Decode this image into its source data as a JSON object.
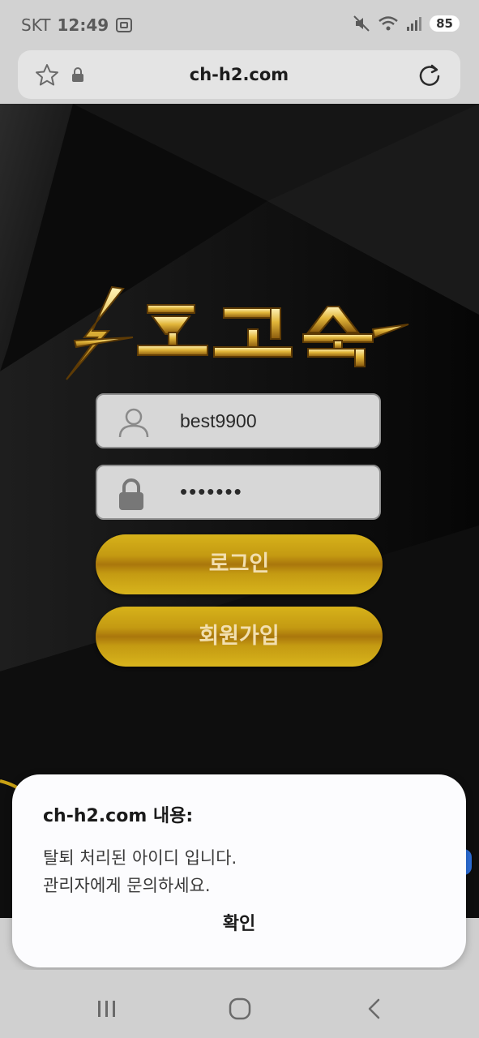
{
  "status_bar": {
    "carrier": "SKT",
    "time": "12:49",
    "battery": "85"
  },
  "browser": {
    "url": "ch-h2.com"
  },
  "login": {
    "username": "best9900",
    "password_masked": "•••••••",
    "login_label": "로그인",
    "signup_label": "회원가입"
  },
  "dialog": {
    "title": "ch-h2.com 내용:",
    "line1": "탈퇴 처리된 아이디 입니다.",
    "line2": "관리자에게 문의하세요.",
    "confirm_label": "확인"
  },
  "icons": {
    "star": "star-icon",
    "lock": "lock-icon",
    "reload": "reload-icon",
    "user": "user-icon",
    "password_lock": "padlock-icon",
    "recents": "recents-icon",
    "home": "home-icon",
    "back": "back-icon"
  },
  "colors": {
    "gold": "#c9a114",
    "button_text": "#f2dfb0",
    "field_bg": "#d7d7d7"
  }
}
